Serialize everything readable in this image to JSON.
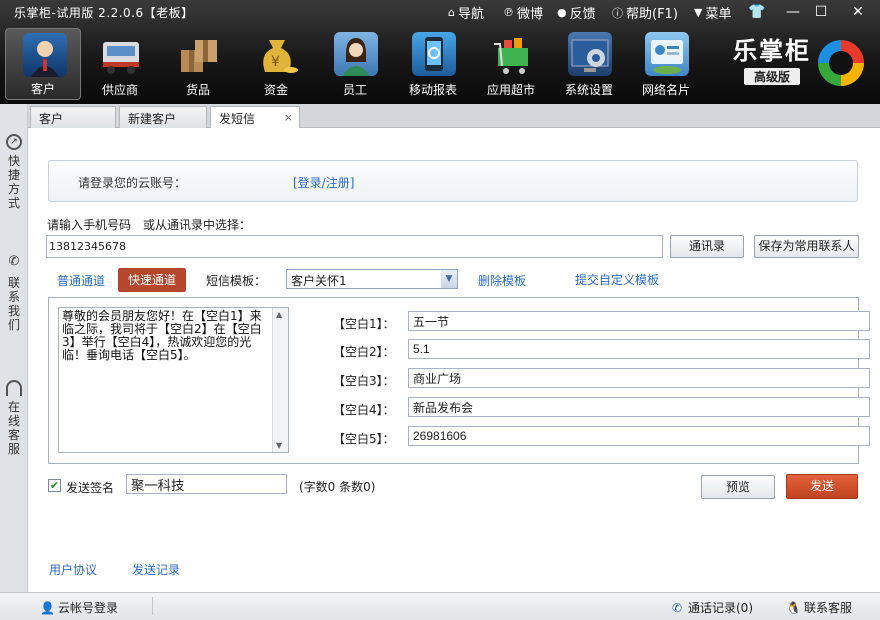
{
  "app": {
    "title": "乐掌柜-试用版 2.2.0.6【老板】",
    "links": [
      {
        "icon": "home-icon",
        "glyph": "⌂",
        "label": "导航"
      },
      {
        "icon": "weibo-icon",
        "glyph": "℗",
        "label": "微博"
      },
      {
        "icon": "feedback-icon",
        "glyph": "●",
        "label": "反馈"
      },
      {
        "icon": "help-icon",
        "glyph": "ⓘ",
        "label": "帮助(F1)"
      },
      {
        "icon": "menu-icon",
        "glyph": "▼",
        "label": "菜单"
      }
    ],
    "window_controls": {
      "skin": "👕",
      "minimize": "—",
      "maximize": "☐",
      "close": "✕"
    }
  },
  "nav": {
    "items": [
      {
        "label": "客户",
        "icon": "customer-icon",
        "active": true
      },
      {
        "label": "供应商",
        "icon": "supplier-truck-icon"
      },
      {
        "label": "货品",
        "icon": "goods-box-icon"
      },
      {
        "label": "资金",
        "icon": "money-bag-icon"
      },
      {
        "label": "员工",
        "icon": "employee-icon"
      },
      {
        "label": "移动报表",
        "icon": "mobile-report-icon"
      },
      {
        "label": "应用超市",
        "icon": "app-market-cart-icon"
      },
      {
        "label": "系统设置",
        "icon": "settings-gear-icon"
      },
      {
        "label": "网络名片",
        "icon": "business-card-icon"
      }
    ]
  },
  "brand": {
    "name": "乐掌柜",
    "edition": "高级版"
  },
  "sidebar": {
    "items": [
      {
        "label": "快捷方式",
        "icon": "shortcut-icon"
      },
      {
        "label": "联系我们",
        "icon": "phone-icon"
      },
      {
        "label": "在线客服",
        "icon": "headset-icon"
      }
    ]
  },
  "tabs": [
    {
      "label": "客户"
    },
    {
      "label": "新建客户"
    },
    {
      "label": "发短信",
      "active": true,
      "close": "×"
    }
  ],
  "sms": {
    "login_label": "请登录您的云账号：",
    "login_link": "[登录/注册]",
    "phone_label": "请输入手机号码　或从通讯录中选择：",
    "phone_value": "13812345678",
    "contacts_button": "通讯录",
    "save_contact_button": "保存为常用联系人",
    "channel_normal": "普通通道",
    "channel_fast": "快速通道",
    "template_label": "短信模板：",
    "template_value": "客户关怀1",
    "template_delete": "删除模板",
    "template_submit": "提交自定义模板",
    "message": "尊敬的会员朋友您好！在【空白1】来临之际，我司将于【空白2】在【空白3】举行【空白4】，热诚欢迎您的光临！垂询电话【空白5】。",
    "blanks": [
      {
        "label": "【空白1】：",
        "value": "五一节"
      },
      {
        "label": "【空白2】：",
        "value": "5.1"
      },
      {
        "label": "【空白3】：",
        "value": "商业广场"
      },
      {
        "label": "【空白4】：",
        "value": "新品发布会"
      },
      {
        "label": "【空白5】：",
        "value": "26981606"
      }
    ],
    "signature_checked": "✔",
    "signature_label": "发送签名",
    "signature_value": "聚一科技",
    "counts": "(字数0 条数0)",
    "preview_button": "预览",
    "send_button": "发送",
    "agreement_link": "用户协议",
    "history_link": "发送记录"
  },
  "status": {
    "cloud_login": "云帐号登录",
    "call_record": "通话记录(0)",
    "contact_service": "联系客服"
  }
}
